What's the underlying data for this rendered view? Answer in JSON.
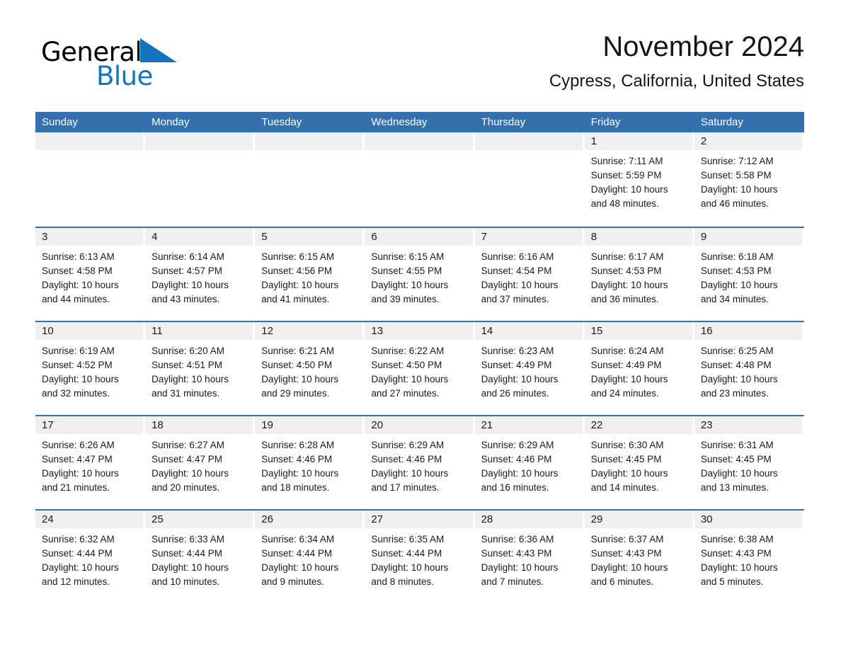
{
  "brand": {
    "name_part1": "General",
    "name_part2": "Blue",
    "triangle_color": "#1473BD",
    "text_color": "#000000"
  },
  "header": {
    "month_title": "November 2024",
    "location": "Cypress, California, United States"
  },
  "theme": {
    "header_blue": "#3470AC",
    "day_band_gray": "#F0F0F0",
    "row_rule_blue": "#3470AC",
    "text": "#1a1a1a"
  },
  "weekdays": [
    "Sunday",
    "Monday",
    "Tuesday",
    "Wednesday",
    "Thursday",
    "Friday",
    "Saturday"
  ],
  "weeks": [
    [
      {
        "day": "",
        "lines": []
      },
      {
        "day": "",
        "lines": []
      },
      {
        "day": "",
        "lines": []
      },
      {
        "day": "",
        "lines": []
      },
      {
        "day": "",
        "lines": []
      },
      {
        "day": "1",
        "lines": [
          "Sunrise: 7:11 AM",
          "Sunset: 5:59 PM",
          "Daylight: 10 hours",
          "and 48 minutes."
        ]
      },
      {
        "day": "2",
        "lines": [
          "Sunrise: 7:12 AM",
          "Sunset: 5:58 PM",
          "Daylight: 10 hours",
          "and 46 minutes."
        ]
      }
    ],
    [
      {
        "day": "3",
        "lines": [
          "Sunrise: 6:13 AM",
          "Sunset: 4:58 PM",
          "Daylight: 10 hours",
          "and 44 minutes."
        ]
      },
      {
        "day": "4",
        "lines": [
          "Sunrise: 6:14 AM",
          "Sunset: 4:57 PM",
          "Daylight: 10 hours",
          "and 43 minutes."
        ]
      },
      {
        "day": "5",
        "lines": [
          "Sunrise: 6:15 AM",
          "Sunset: 4:56 PM",
          "Daylight: 10 hours",
          "and 41 minutes."
        ]
      },
      {
        "day": "6",
        "lines": [
          "Sunrise: 6:15 AM",
          "Sunset: 4:55 PM",
          "Daylight: 10 hours",
          "and 39 minutes."
        ]
      },
      {
        "day": "7",
        "lines": [
          "Sunrise: 6:16 AM",
          "Sunset: 4:54 PM",
          "Daylight: 10 hours",
          "and 37 minutes."
        ]
      },
      {
        "day": "8",
        "lines": [
          "Sunrise: 6:17 AM",
          "Sunset: 4:53 PM",
          "Daylight: 10 hours",
          "and 36 minutes."
        ]
      },
      {
        "day": "9",
        "lines": [
          "Sunrise: 6:18 AM",
          "Sunset: 4:53 PM",
          "Daylight: 10 hours",
          "and 34 minutes."
        ]
      }
    ],
    [
      {
        "day": "10",
        "lines": [
          "Sunrise: 6:19 AM",
          "Sunset: 4:52 PM",
          "Daylight: 10 hours",
          "and 32 minutes."
        ]
      },
      {
        "day": "11",
        "lines": [
          "Sunrise: 6:20 AM",
          "Sunset: 4:51 PM",
          "Daylight: 10 hours",
          "and 31 minutes."
        ]
      },
      {
        "day": "12",
        "lines": [
          "Sunrise: 6:21 AM",
          "Sunset: 4:50 PM",
          "Daylight: 10 hours",
          "and 29 minutes."
        ]
      },
      {
        "day": "13",
        "lines": [
          "Sunrise: 6:22 AM",
          "Sunset: 4:50 PM",
          "Daylight: 10 hours",
          "and 27 minutes."
        ]
      },
      {
        "day": "14",
        "lines": [
          "Sunrise: 6:23 AM",
          "Sunset: 4:49 PM",
          "Daylight: 10 hours",
          "and 26 minutes."
        ]
      },
      {
        "day": "15",
        "lines": [
          "Sunrise: 6:24 AM",
          "Sunset: 4:49 PM",
          "Daylight: 10 hours",
          "and 24 minutes."
        ]
      },
      {
        "day": "16",
        "lines": [
          "Sunrise: 6:25 AM",
          "Sunset: 4:48 PM",
          "Daylight: 10 hours",
          "and 23 minutes."
        ]
      }
    ],
    [
      {
        "day": "17",
        "lines": [
          "Sunrise: 6:26 AM",
          "Sunset: 4:47 PM",
          "Daylight: 10 hours",
          "and 21 minutes."
        ]
      },
      {
        "day": "18",
        "lines": [
          "Sunrise: 6:27 AM",
          "Sunset: 4:47 PM",
          "Daylight: 10 hours",
          "and 20 minutes."
        ]
      },
      {
        "day": "19",
        "lines": [
          "Sunrise: 6:28 AM",
          "Sunset: 4:46 PM",
          "Daylight: 10 hours",
          "and 18 minutes."
        ]
      },
      {
        "day": "20",
        "lines": [
          "Sunrise: 6:29 AM",
          "Sunset: 4:46 PM",
          "Daylight: 10 hours",
          "and 17 minutes."
        ]
      },
      {
        "day": "21",
        "lines": [
          "Sunrise: 6:29 AM",
          "Sunset: 4:46 PM",
          "Daylight: 10 hours",
          "and 16 minutes."
        ]
      },
      {
        "day": "22",
        "lines": [
          "Sunrise: 6:30 AM",
          "Sunset: 4:45 PM",
          "Daylight: 10 hours",
          "and 14 minutes."
        ]
      },
      {
        "day": "23",
        "lines": [
          "Sunrise: 6:31 AM",
          "Sunset: 4:45 PM",
          "Daylight: 10 hours",
          "and 13 minutes."
        ]
      }
    ],
    [
      {
        "day": "24",
        "lines": [
          "Sunrise: 6:32 AM",
          "Sunset: 4:44 PM",
          "Daylight: 10 hours",
          "and 12 minutes."
        ]
      },
      {
        "day": "25",
        "lines": [
          "Sunrise: 6:33 AM",
          "Sunset: 4:44 PM",
          "Daylight: 10 hours",
          "and 10 minutes."
        ]
      },
      {
        "day": "26",
        "lines": [
          "Sunrise: 6:34 AM",
          "Sunset: 4:44 PM",
          "Daylight: 10 hours",
          "and 9 minutes."
        ]
      },
      {
        "day": "27",
        "lines": [
          "Sunrise: 6:35 AM",
          "Sunset: 4:44 PM",
          "Daylight: 10 hours",
          "and 8 minutes."
        ]
      },
      {
        "day": "28",
        "lines": [
          "Sunrise: 6:36 AM",
          "Sunset: 4:43 PM",
          "Daylight: 10 hours",
          "and 7 minutes."
        ]
      },
      {
        "day": "29",
        "lines": [
          "Sunrise: 6:37 AM",
          "Sunset: 4:43 PM",
          "Daylight: 10 hours",
          "and 6 minutes."
        ]
      },
      {
        "day": "30",
        "lines": [
          "Sunrise: 6:38 AM",
          "Sunset: 4:43 PM",
          "Daylight: 10 hours",
          "and 5 minutes."
        ]
      }
    ]
  ]
}
